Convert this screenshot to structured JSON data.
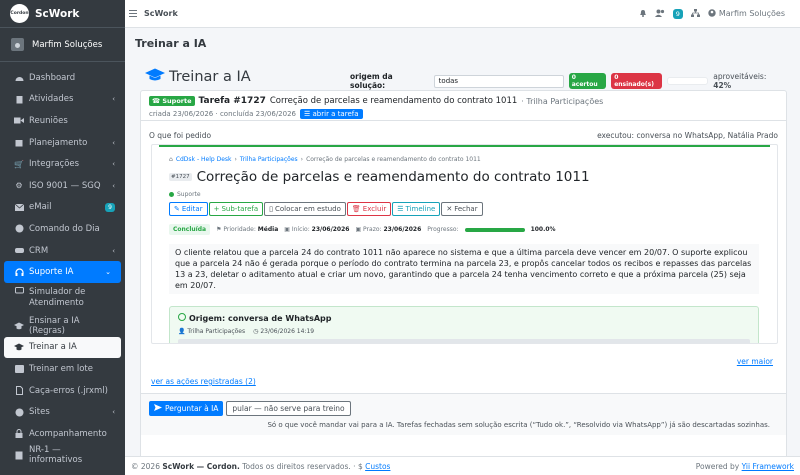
{
  "brand": {
    "logo_text": "Cordon",
    "name": "ScWork"
  },
  "user": {
    "name": "Marfim Soluções"
  },
  "sidebar": {
    "items": [
      {
        "label": "Dashboard",
        "icon": "tachometer-icon"
      },
      {
        "label": "Atividades",
        "icon": "clipboard-icon"
      },
      {
        "label": "Reuniões",
        "icon": "video-icon"
      },
      {
        "label": "Planejamento",
        "icon": "calendar-icon"
      },
      {
        "label": "Integrações",
        "icon": "shopping-cart-icon"
      },
      {
        "label": "ISO 9001 — SGQ",
        "icon": "gear-icon"
      },
      {
        "label": "eMail",
        "icon": "envelope-icon",
        "badge": "9"
      },
      {
        "label": "Comando do Dia",
        "icon": "compass-icon"
      },
      {
        "label": "CRM",
        "icon": "handshake-icon"
      },
      {
        "label": "Suporte IA",
        "icon": "headset-icon"
      },
      {
        "label": "Simulador de Atendimento",
        "icon": "chat-icon"
      },
      {
        "label": "Ensinar a IA (Regras)",
        "icon": "graduation-cap-icon"
      },
      {
        "label": "Treinar a IA",
        "icon": "graduation-cap-icon"
      },
      {
        "label": "Treinar em lote",
        "icon": "layer-icon"
      },
      {
        "label": "Caça-erros (.jrxml)",
        "icon": "file-icon"
      },
      {
        "label": "Sites",
        "icon": "globe-icon"
      },
      {
        "label": "Acompanhamento",
        "icon": "lock-icon"
      },
      {
        "label": "NR-1 — informativos",
        "icon": "info-icon"
      }
    ]
  },
  "topbar": {
    "title": "ScWork",
    "badge": "9",
    "user": "Marfim Soluções"
  },
  "page": {
    "header": "Treinar a IA",
    "title": "Treinar a IA",
    "origem_label": "origem da solução:",
    "origem_value": "todas",
    "acertou": "0 acertou",
    "ensinado": "0 ensinado(s)",
    "aprov_label": "aproveitáveis:",
    "aprov_value": "42%"
  },
  "task": {
    "tag": "Suporte",
    "id": "Tarefa #1727",
    "title": "Correção de parcelas e reamendamento do contrato 1011",
    "project": "· Trilha Participações",
    "dates": "criada 23/06/2026 · concluída 23/06/2026",
    "open_button": "abrir a tarefa",
    "pedido_label": "O que foi pedido",
    "executou": "executou: conversa no WhatsApp, Natália Prado"
  },
  "embed": {
    "crumb1": "CdDsk - Help Desk",
    "crumb2": "Trilha Participações",
    "crumb3": "Correção de parcelas e reamendamento do contrato 1011",
    "id": "#1727",
    "title": "Correção de parcelas e reamendamento do contrato 1011",
    "status": "Suporte",
    "buttons": {
      "editar": "Editar",
      "subtarefa": "Sub-tarefa",
      "estudo": "Colocar em estudo",
      "excluir": "Excluir",
      "timeline": "Timeline",
      "fechar": "Fechar"
    },
    "concluida": "Concluída",
    "prioridade_label": "Prioridade:",
    "prioridade": "Média",
    "inicio_label": "Início:",
    "inicio": "23/06/2026",
    "prazo_label": "Prazo:",
    "prazo": "23/06/2026",
    "progresso_label": "Progresso:",
    "progresso": "100.0%",
    "description": "O cliente relatou que a parcela 24 do contrato 1011 não aparece no sistema e que a última parcela deve vencer em 20/07. O suporte explicou que a parcela 24 não é gerada porque o período do contrato termina na parcela 23, e propôs cancelar todos os recibos e repasses das parcelas 13 a 23, deletar o aditamento atual e criar um novo, garantindo que a parcela 24 tenha vencimento correto e que a próxima parcela (25) seja em 20/07.",
    "origem_title": "Origem: conversa de WhatsApp",
    "origem_project": "Trilha Participações",
    "origem_datetime": "23/06/2026 14:19"
  },
  "links": {
    "ver_maior": "ver maior",
    "ver_acoes": "ver as ações registradas (2)"
  },
  "footer_card": {
    "perguntar": "Perguntar à IA",
    "pular": "pular — não serve para treino",
    "note": "Só o que você mandar vai para a IA. Tarefas fechadas sem solução escrita (“Tudo ok.”, “Resolvido via WhatsApp”) já são descartadas sozinhas."
  },
  "footer": {
    "copyright": "© 2026",
    "brand": "ScWork — Cordon.",
    "rights": "Todos os direitos reservados.",
    "sep": "·",
    "custos": "Custos",
    "powered": "Powered by",
    "framework": "Yii Framework"
  },
  "colors": {
    "sidebar_bg": "#343a40",
    "primary": "#007bff",
    "success": "#28a745",
    "danger": "#dc3545",
    "info": "#17a2b8"
  }
}
